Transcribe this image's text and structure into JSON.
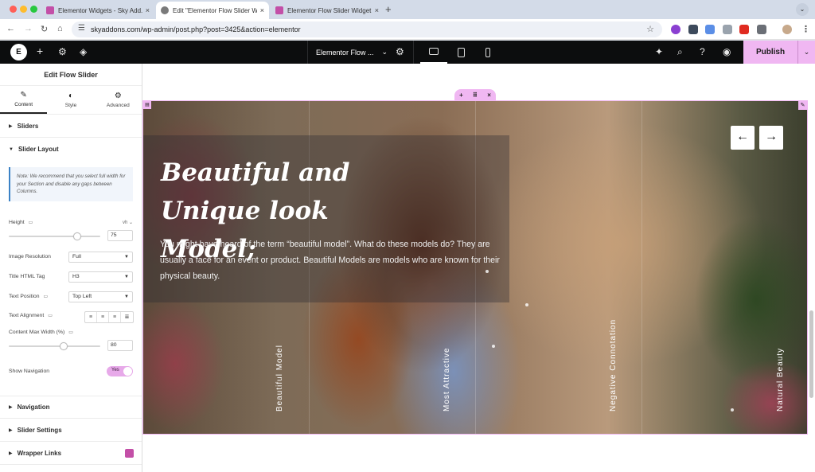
{
  "browser": {
    "tabs": [
      {
        "title": "Elementor Widgets - Sky Add...",
        "active": false,
        "favicon_color": "#c34fa7"
      },
      {
        "title": "Edit \"Elementor Flow Slider W...",
        "active": true,
        "favicon_color": "#7a7a7a"
      },
      {
        "title": "Elementor Flow Slider Widget...",
        "active": false,
        "favicon_color": "#c34fa7"
      }
    ],
    "close_glyph": "×",
    "new_tab_glyph": "+",
    "url": "skyaddons.com/wp-admin/post.php?post=3425&action=elementor"
  },
  "elementor": {
    "logo_glyph": "E",
    "document_name": "Elementor Flow ...",
    "publish_label": "Publish"
  },
  "panel": {
    "title": "Edit Flow Slider",
    "tabs": [
      {
        "label": "Content",
        "icon": "pencil-icon",
        "glyph": "✎"
      },
      {
        "label": "Style",
        "icon": "half-circle-icon",
        "glyph": "◐"
      },
      {
        "label": "Advanced",
        "icon": "gear-icon",
        "glyph": "⚙"
      }
    ],
    "sections_top": [
      {
        "label": "Sliders",
        "open": false
      }
    ],
    "slider_layout": {
      "label": "Slider Layout",
      "note": "Note: We recommend that you select full width for your Section and disable any gaps between Columns.",
      "height": {
        "label": "Height",
        "unit": "vh",
        "value": "75",
        "slider_fraction": 0.75
      },
      "image_resolution": {
        "label": "Image Resolution",
        "value": "Full"
      },
      "title_html_tag": {
        "label": "Title HTML Tag",
        "value": "H3"
      },
      "text_position": {
        "label": "Text Position",
        "value": "Top Left"
      },
      "text_alignment": {
        "label": "Text Alignment"
      },
      "content_max_width": {
        "label": "Content Max Width (%)",
        "value": "80",
        "slider_fraction": 0.8
      },
      "show_navigation": {
        "label": "Show Navigation",
        "value": "Yes"
      }
    },
    "sections_bottom": [
      {
        "label": "Navigation"
      },
      {
        "label": "Slider Settings"
      },
      {
        "label": "Wrapper Links"
      }
    ]
  },
  "slider": {
    "title": "Beautiful and Unique look Model;",
    "description": "You might have heard of the term “beautiful model”. What do these models do? They are usually a face for an event or product. Beautiful Models are models who are known for their physical beauty.",
    "prev_glyph": "←",
    "next_glyph": "→",
    "slide_labels": [
      "Beautiful Model",
      "Most Attractive",
      "Negative Connotation",
      "Natural Beauty"
    ]
  },
  "colors": {
    "accent_pink": "#f0b7f2",
    "toolbar_dark": "#0c0d0e"
  }
}
